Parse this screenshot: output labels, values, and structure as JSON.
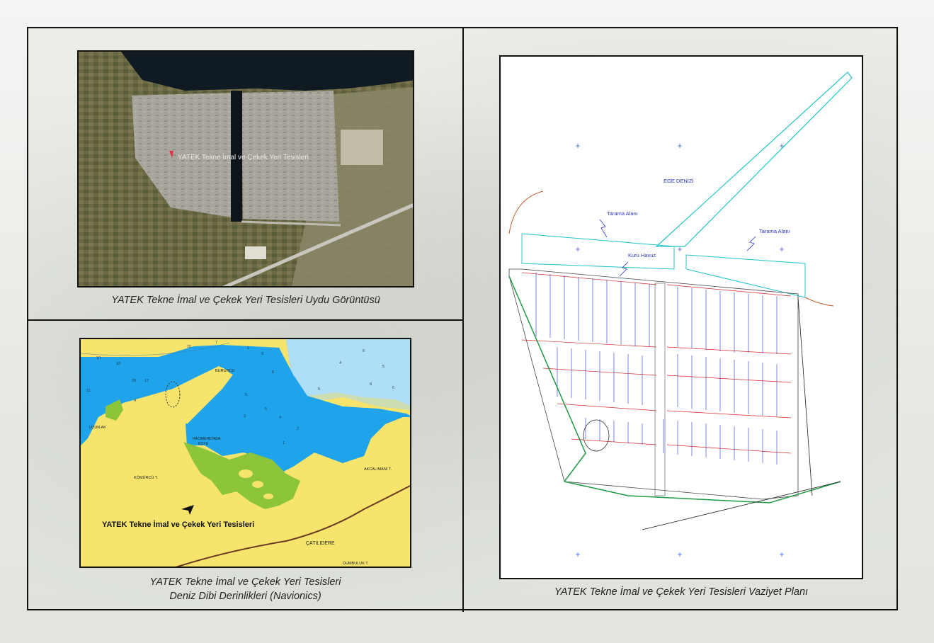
{
  "satellite": {
    "label": "YATEK Tekne İmal ve Çekek Yeri Tesisleri",
    "caption": "YATEK Tekne İmal ve Çekek Yeri Tesisleri Uydu Görüntüsü"
  },
  "nautical_chart": {
    "facility_label": "YATEK Tekne İmal ve Çekek Yeri Tesisleri",
    "caption_line1": "YATEK Tekne İmal ve Çekek Yeri Tesisleri",
    "caption_line2": "Deniz Dibi Derinlikleri (Navionics)",
    "place_names": {
      "burun": "BURUNCU",
      "uzun": "UZUN AK",
      "hacimeta": "HACIMEHETADA",
      "koyu": "KOYU",
      "komurcu": "KÖMÜRCÜ T.",
      "akcaliman": "AKCALIMANI T.",
      "catili": "ÇATILIDERE",
      "dumbuluk": "DUMBULUK T."
    },
    "depths": [
      "10",
      "33",
      "29",
      "15",
      "7",
      "1",
      "9",
      "8",
      "5",
      "6",
      "3",
      "4",
      "2",
      "1",
      "17",
      "21",
      "4",
      "6",
      "5",
      "6",
      "5",
      "4",
      "5"
    ]
  },
  "site_plan": {
    "sea_label": "EGE DENİZİ",
    "dredge_left": "Tarama Alanı",
    "dredge_right": "Tarama Alanı",
    "dry_dock": "Kuru Havuz",
    "caption": "YATEK Tekne İmal ve Çekek Yeri Tesisleri Vaziyet Planı"
  }
}
